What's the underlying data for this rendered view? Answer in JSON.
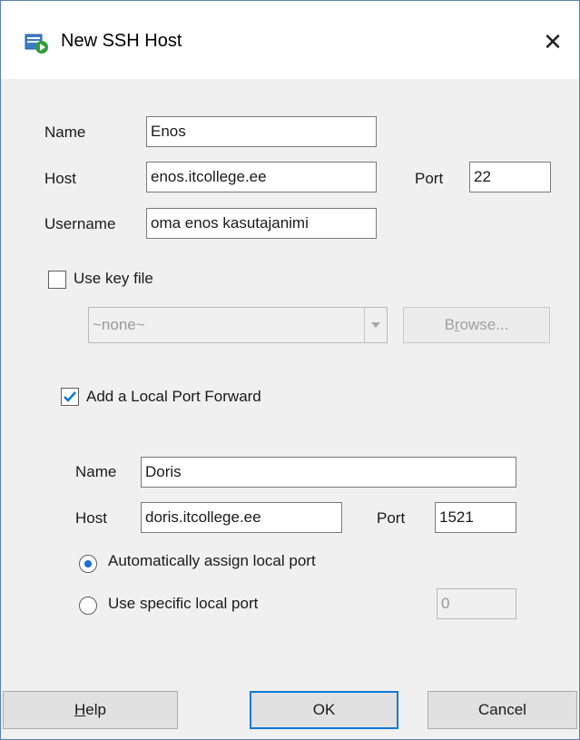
{
  "window": {
    "title": "New SSH Host",
    "close_glyph": "✕"
  },
  "ssh": {
    "name_label": "Name",
    "name_value": "Enos",
    "host_label": "Host",
    "host_value": "enos.itcollege.ee",
    "port_label": "Port",
    "port_value": "22",
    "username_label": "Username",
    "username_value": "oma enos kasutajanimi"
  },
  "key_file": {
    "label": "Use key file",
    "checked": false,
    "select_value": "~none~",
    "browse_label_pre": "B",
    "browse_label_u": "r",
    "browse_label_post": "owse..."
  },
  "forward": {
    "label": "Add a Local Port Forward",
    "checked": true,
    "name_label": "Name",
    "name_value": "Doris",
    "host_label": "Host",
    "host_value": "doris.itcollege.ee",
    "port_label": "Port",
    "port_value": "1521",
    "auto_label": "Automatically assign local port",
    "specific_label": "Use specific local port",
    "specific_port_value": "0",
    "selected_option": "auto"
  },
  "buttons": {
    "help_u": "H",
    "help_rest": "elp",
    "ok": "OK",
    "cancel": "Cancel"
  },
  "colors": {
    "accent": "#0b78d7",
    "icon_green": "#2e9e3f",
    "icon_blue": "#3d7cc9"
  }
}
